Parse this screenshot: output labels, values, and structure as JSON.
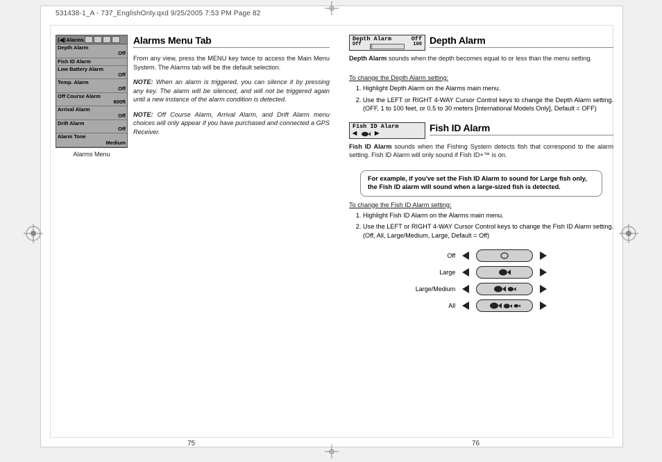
{
  "print_header": "531438-1_A - 737_EnglishOnly.qxd  9/25/2005  7:53 PM  Page 82",
  "left_page": {
    "menu": {
      "header_label": "Alarms",
      "rows": [
        {
          "label": "Depth Alarm",
          "value": "Off"
        },
        {
          "label": "Fish ID Alarm",
          "value": ""
        },
        {
          "label": "Low Battery Alarm",
          "value": "Off"
        },
        {
          "label": "Temp. Alarm",
          "value": "Off"
        },
        {
          "label": "Off Course Alarm",
          "value": "600ft"
        },
        {
          "label": "Arrival Alarm",
          "value": "Off"
        },
        {
          "label": "Drift Alarm",
          "value": "Off"
        },
        {
          "label": "Alarm Tone",
          "value": "Medium"
        }
      ],
      "caption": "Alarms Menu"
    },
    "section_title": "Alarms Menu Tab",
    "intro": "From any view, press the MENU key twice to access the Main Menu System. The Alarms tab will be the default selection.",
    "note1_label": "NOTE:",
    "note1": "When an alarm is triggered, you can silence it by pressing any key.  The alarm will be silenced, and will not be triggered again until a new instance of the alarm condition is detected.",
    "note2_label": "NOTE:",
    "note2": "Off Course Alarm, Arrival Alarm, and Drift Alarm menu choices will only appear if you have purchased and connected a GPS Receiver.",
    "page_number": "75"
  },
  "right_page": {
    "depth": {
      "box_label": "Depth Alarm",
      "box_state": "Off",
      "box_left": "Off",
      "box_right": "100",
      "title": "Depth Alarm",
      "intro_bold": "Depth Alarm",
      "intro_rest": " sounds when the depth becomes equal to or less than the menu setting.",
      "change_heading": "To change the Depth Alarm setting:",
      "steps": [
        "Highlight Depth Alarm on the Alarms main menu.",
        "Use the LEFT or RIGHT 4-WAY Cursor Control keys to change the Depth Alarm setting. (OFF, 1 to 100 feet, or 0.5 to 30 meters [International Models Only], Default = OFF)"
      ]
    },
    "fishid": {
      "box_label": "Fish ID Alarm",
      "title": "Fish ID Alarm",
      "intro_bold": "Fish ID Alarm",
      "intro_rest": " sounds when the Fishing System detects fish that correspond to the alarm setting. Fish ID Alarm will only sound if Fish ID+™ is on.",
      "example": "For example, if you've set the Fish ID Alarm to sound for Large fish only, the Fish ID alarm will sound when a large-sized fish is detected.",
      "change_heading": "To change the Fish ID Alarm setting:",
      "steps": [
        "Highlight Fish ID Alarm on the Alarms main menu.",
        "Use the LEFT or RIGHT 4-WAY Cursor Control keys to change the Fish ID Alarm setting. (Off, All, Large/Medium, Large, Default = Off)"
      ],
      "options": [
        "Off",
        "Large",
        "Large/Medium",
        "All"
      ]
    },
    "page_number": "76"
  }
}
